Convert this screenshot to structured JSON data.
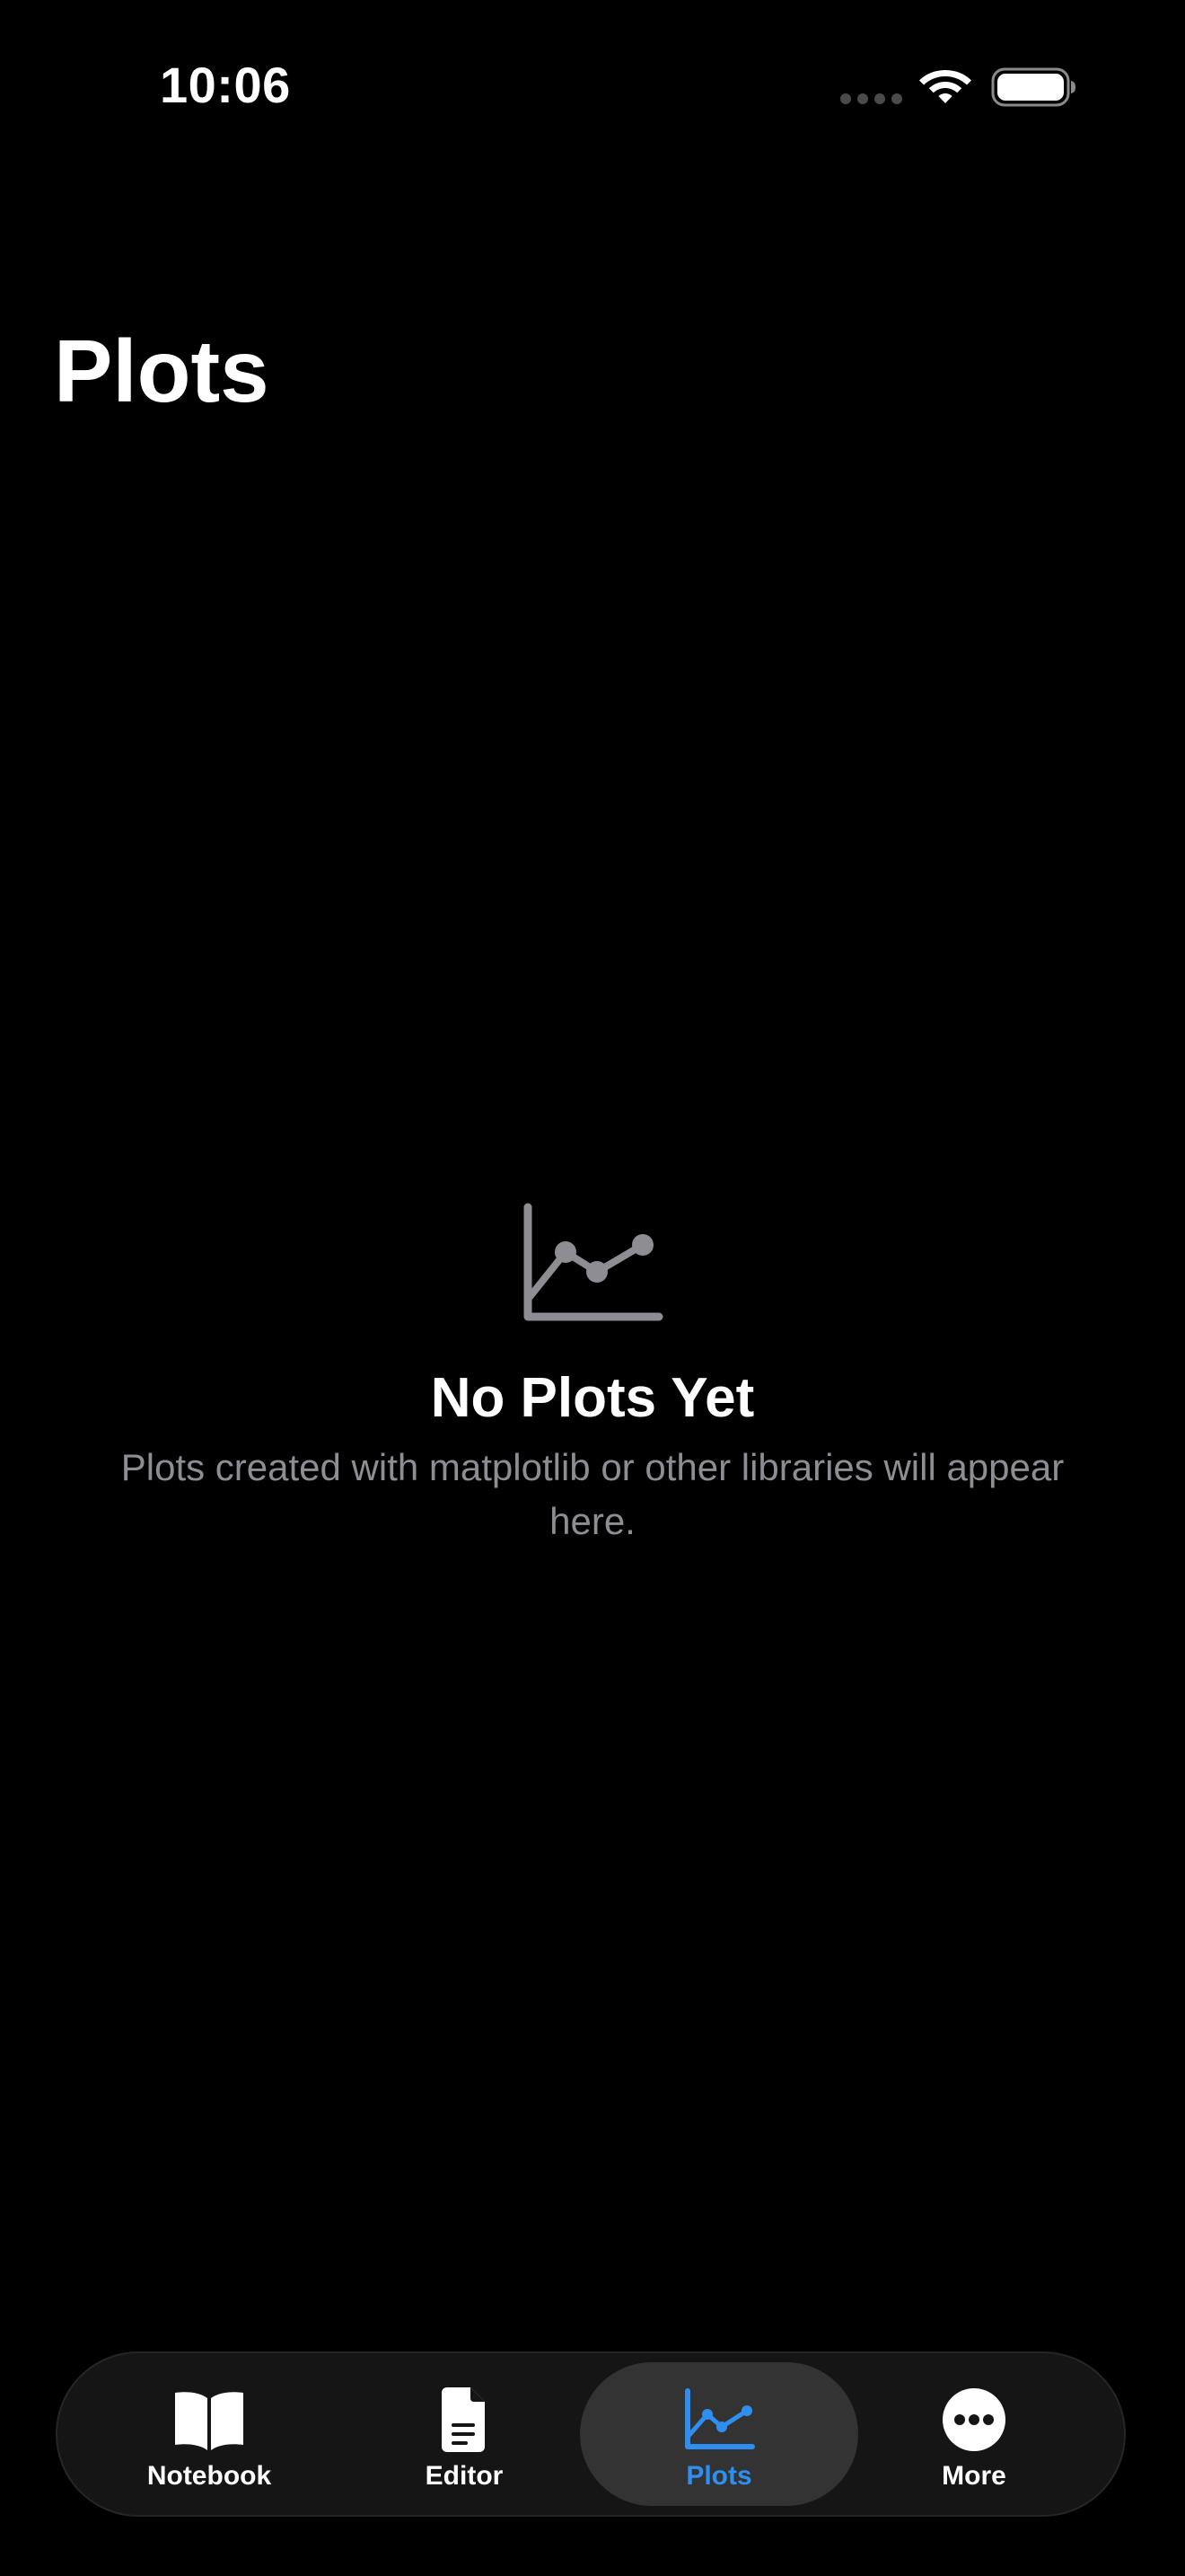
{
  "status_bar": {
    "time": "10:06"
  },
  "header": {
    "title": "Plots"
  },
  "empty_state": {
    "icon": "chart-line-icon",
    "title": "No Plots Yet",
    "message": "Plots created with matplotlib or other libraries will appear here."
  },
  "tab_bar": {
    "active_tab": "Plots",
    "active_color": "#2f8ff0",
    "tabs": [
      {
        "label": "Notebook",
        "icon": "book-icon"
      },
      {
        "label": "Editor",
        "icon": "document-icon"
      },
      {
        "label": "Plots",
        "icon": "chart-line-icon"
      },
      {
        "label": "More",
        "icon": "ellipsis-circle-icon"
      }
    ]
  }
}
